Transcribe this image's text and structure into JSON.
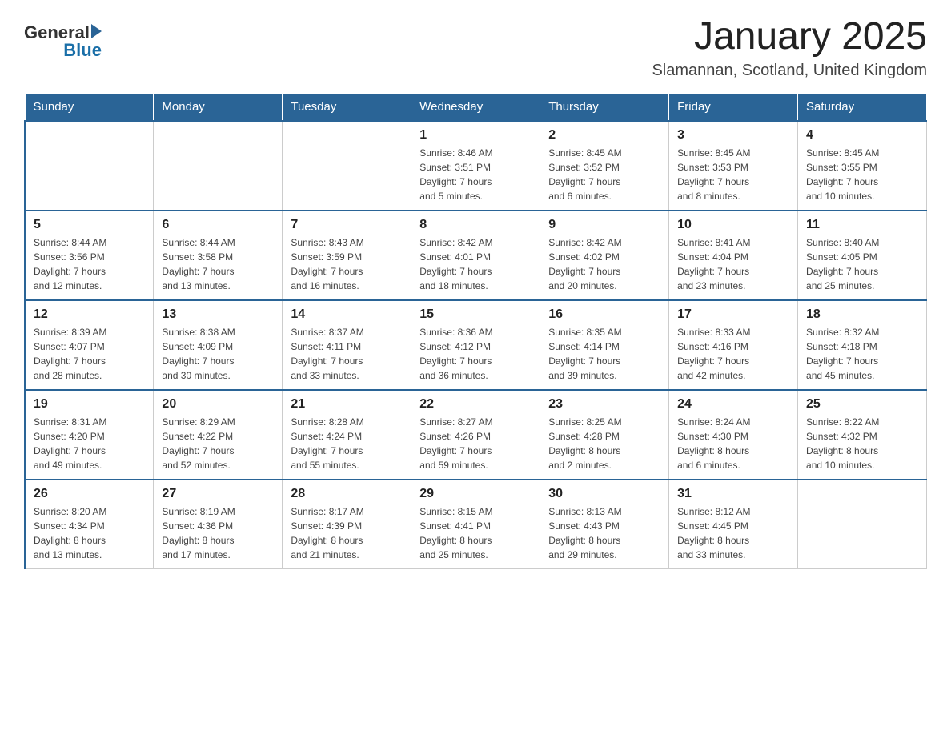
{
  "header": {
    "title": "January 2025",
    "subtitle": "Slamannan, Scotland, United Kingdom",
    "logo": {
      "general": "General",
      "blue": "Blue"
    }
  },
  "weekdays": [
    "Sunday",
    "Monday",
    "Tuesday",
    "Wednesday",
    "Thursday",
    "Friday",
    "Saturday"
  ],
  "weeks": [
    [
      {
        "day": "",
        "info": ""
      },
      {
        "day": "",
        "info": ""
      },
      {
        "day": "",
        "info": ""
      },
      {
        "day": "1",
        "info": "Sunrise: 8:46 AM\nSunset: 3:51 PM\nDaylight: 7 hours\nand 5 minutes."
      },
      {
        "day": "2",
        "info": "Sunrise: 8:45 AM\nSunset: 3:52 PM\nDaylight: 7 hours\nand 6 minutes."
      },
      {
        "day": "3",
        "info": "Sunrise: 8:45 AM\nSunset: 3:53 PM\nDaylight: 7 hours\nand 8 minutes."
      },
      {
        "day": "4",
        "info": "Sunrise: 8:45 AM\nSunset: 3:55 PM\nDaylight: 7 hours\nand 10 minutes."
      }
    ],
    [
      {
        "day": "5",
        "info": "Sunrise: 8:44 AM\nSunset: 3:56 PM\nDaylight: 7 hours\nand 12 minutes."
      },
      {
        "day": "6",
        "info": "Sunrise: 8:44 AM\nSunset: 3:58 PM\nDaylight: 7 hours\nand 13 minutes."
      },
      {
        "day": "7",
        "info": "Sunrise: 8:43 AM\nSunset: 3:59 PM\nDaylight: 7 hours\nand 16 minutes."
      },
      {
        "day": "8",
        "info": "Sunrise: 8:42 AM\nSunset: 4:01 PM\nDaylight: 7 hours\nand 18 minutes."
      },
      {
        "day": "9",
        "info": "Sunrise: 8:42 AM\nSunset: 4:02 PM\nDaylight: 7 hours\nand 20 minutes."
      },
      {
        "day": "10",
        "info": "Sunrise: 8:41 AM\nSunset: 4:04 PM\nDaylight: 7 hours\nand 23 minutes."
      },
      {
        "day": "11",
        "info": "Sunrise: 8:40 AM\nSunset: 4:05 PM\nDaylight: 7 hours\nand 25 minutes."
      }
    ],
    [
      {
        "day": "12",
        "info": "Sunrise: 8:39 AM\nSunset: 4:07 PM\nDaylight: 7 hours\nand 28 minutes."
      },
      {
        "day": "13",
        "info": "Sunrise: 8:38 AM\nSunset: 4:09 PM\nDaylight: 7 hours\nand 30 minutes."
      },
      {
        "day": "14",
        "info": "Sunrise: 8:37 AM\nSunset: 4:11 PM\nDaylight: 7 hours\nand 33 minutes."
      },
      {
        "day": "15",
        "info": "Sunrise: 8:36 AM\nSunset: 4:12 PM\nDaylight: 7 hours\nand 36 minutes."
      },
      {
        "day": "16",
        "info": "Sunrise: 8:35 AM\nSunset: 4:14 PM\nDaylight: 7 hours\nand 39 minutes."
      },
      {
        "day": "17",
        "info": "Sunrise: 8:33 AM\nSunset: 4:16 PM\nDaylight: 7 hours\nand 42 minutes."
      },
      {
        "day": "18",
        "info": "Sunrise: 8:32 AM\nSunset: 4:18 PM\nDaylight: 7 hours\nand 45 minutes."
      }
    ],
    [
      {
        "day": "19",
        "info": "Sunrise: 8:31 AM\nSunset: 4:20 PM\nDaylight: 7 hours\nand 49 minutes."
      },
      {
        "day": "20",
        "info": "Sunrise: 8:29 AM\nSunset: 4:22 PM\nDaylight: 7 hours\nand 52 minutes."
      },
      {
        "day": "21",
        "info": "Sunrise: 8:28 AM\nSunset: 4:24 PM\nDaylight: 7 hours\nand 55 minutes."
      },
      {
        "day": "22",
        "info": "Sunrise: 8:27 AM\nSunset: 4:26 PM\nDaylight: 7 hours\nand 59 minutes."
      },
      {
        "day": "23",
        "info": "Sunrise: 8:25 AM\nSunset: 4:28 PM\nDaylight: 8 hours\nand 2 minutes."
      },
      {
        "day": "24",
        "info": "Sunrise: 8:24 AM\nSunset: 4:30 PM\nDaylight: 8 hours\nand 6 minutes."
      },
      {
        "day": "25",
        "info": "Sunrise: 8:22 AM\nSunset: 4:32 PM\nDaylight: 8 hours\nand 10 minutes."
      }
    ],
    [
      {
        "day": "26",
        "info": "Sunrise: 8:20 AM\nSunset: 4:34 PM\nDaylight: 8 hours\nand 13 minutes."
      },
      {
        "day": "27",
        "info": "Sunrise: 8:19 AM\nSunset: 4:36 PM\nDaylight: 8 hours\nand 17 minutes."
      },
      {
        "day": "28",
        "info": "Sunrise: 8:17 AM\nSunset: 4:39 PM\nDaylight: 8 hours\nand 21 minutes."
      },
      {
        "day": "29",
        "info": "Sunrise: 8:15 AM\nSunset: 4:41 PM\nDaylight: 8 hours\nand 25 minutes."
      },
      {
        "day": "30",
        "info": "Sunrise: 8:13 AM\nSunset: 4:43 PM\nDaylight: 8 hours\nand 29 minutes."
      },
      {
        "day": "31",
        "info": "Sunrise: 8:12 AM\nSunset: 4:45 PM\nDaylight: 8 hours\nand 33 minutes."
      },
      {
        "day": "",
        "info": ""
      }
    ]
  ]
}
